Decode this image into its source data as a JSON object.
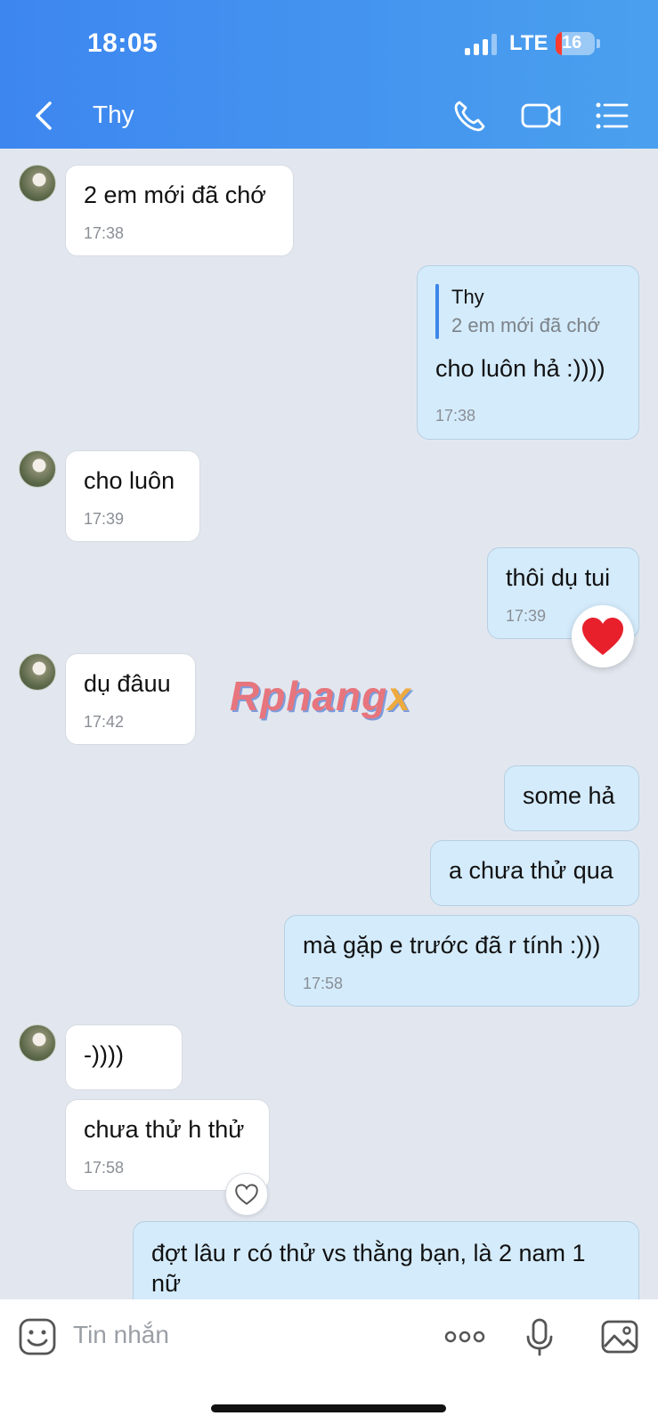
{
  "status_bar": {
    "time": "18:05",
    "network": "LTE",
    "battery": "16"
  },
  "header": {
    "contact_name": "Thy"
  },
  "messages": [
    {
      "text": "2 em mới đã chớ",
      "time": "17:38"
    },
    {
      "quote_name": "Thy",
      "quote_text": "2 em mới đã chớ",
      "text": "cho luôn hả :))))",
      "time": "17:38"
    },
    {
      "text": "cho luôn",
      "time": "17:39"
    },
    {
      "text": "thôi dụ tui",
      "time": "17:39"
    },
    {
      "text": "dụ đâuu",
      "time": "17:42"
    },
    {
      "text": "some hả"
    },
    {
      "text": "a chưa thử qua"
    },
    {
      "text": "mà gặp e trước đã r tính :)))",
      "time": "17:58"
    },
    {
      "text": "-))))"
    },
    {
      "text": "chưa thử h thử",
      "time": "17:58"
    },
    {
      "text": "đợt lâu r có thử vs thằng bạn, là 2 nam 1 nữ"
    }
  ],
  "watermark": {
    "main": "Rphang",
    "suffix": "x"
  },
  "input": {
    "placeholder": "Tin nhắn"
  },
  "colors": {
    "header_start": "#3d86f0",
    "header_end": "#4aa0ee",
    "outgoing_bubble": "#d4ebfb",
    "incoming_bubble": "#ffffff",
    "chat_bg": "#e2e7ef"
  },
  "icons": [
    "back-chevron-icon",
    "phone-icon",
    "video-camera-icon",
    "list-menu-icon",
    "heart-icon",
    "heart-outline-icon",
    "sticker-face-icon",
    "more-dots-icon",
    "microphone-icon",
    "image-icon"
  ]
}
